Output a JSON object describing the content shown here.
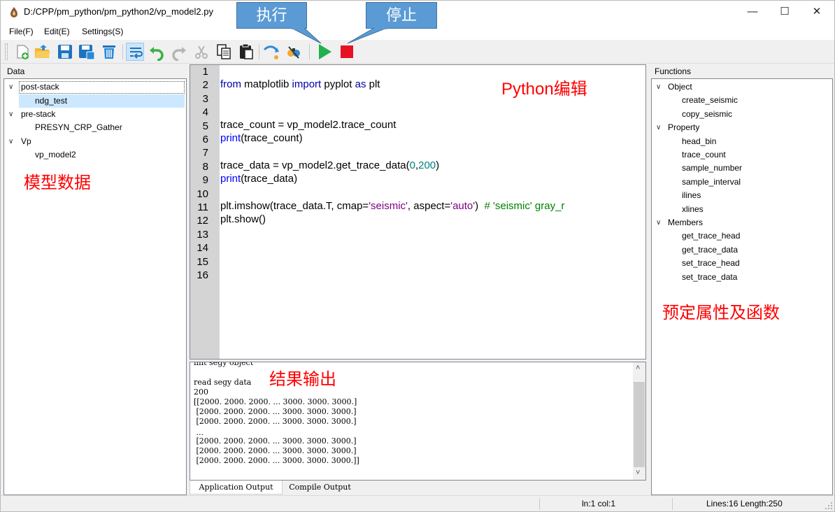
{
  "window": {
    "title": "D:/CPP/pm_python/pm_python2/vp_model2.py",
    "controls": {
      "minimize": "—",
      "maximize": "☐",
      "close": "✕"
    }
  },
  "menu": [
    {
      "label": "File(F)"
    },
    {
      "label": "Edit(E)"
    },
    {
      "label": "Settings(S)"
    }
  ],
  "toolbar": {
    "buttons": [
      "new-file-icon",
      "open-folder-icon",
      "save-icon",
      "save-as-icon",
      "delete-icon",
      "word-wrap-icon",
      "undo-icon",
      "redo-icon",
      "cut-icon",
      "copy-icon",
      "paste-icon",
      "step-icon",
      "debug-icon",
      "run-icon",
      "stop-icon"
    ],
    "run_color": "#22b14c",
    "stop_color": "#e81123"
  },
  "callouts": {
    "run": "执行",
    "stop": "停止",
    "color": "#5b9bd5"
  },
  "data_panel": {
    "header": "Data",
    "tree": [
      {
        "label": "post-stack",
        "children": [
          "ndg_test"
        ]
      },
      {
        "label": "pre-stack",
        "children": [
          "PRESYN_CRP_Gather"
        ]
      },
      {
        "label": "Vp",
        "children": [
          "vp_model2"
        ]
      }
    ],
    "selected": "ndg_test"
  },
  "editor": {
    "line_numbers": [
      "1",
      "2",
      "3",
      "4",
      "5",
      "6",
      "7",
      "8",
      "9",
      "10",
      "11",
      "12",
      "13",
      "14",
      "15",
      "16"
    ],
    "lines": {
      "l2": {
        "k1": "from",
        "t1": " matplotlib ",
        "k2": "import",
        "t2": " pyplot ",
        "k3": "as",
        "t3": " plt"
      },
      "l5": "trace_count = vp_model2.trace_count",
      "l6": {
        "f": "print",
        "t": "(trace_count)"
      },
      "l8": {
        "t1": "trace_data = vp_model2.get_trace_data(",
        "n1": "0",
        "c": ",",
        "n2": "200",
        "t2": ")"
      },
      "l9": {
        "f": "print",
        "t": "(trace_data)"
      },
      "l11": {
        "t1": "plt.imshow(trace_data.T, cmap=",
        "s1": "'seismic'",
        "t2": ", aspect=",
        "s2": "'auto'",
        "t3": ")  ",
        "cm": "# 'seismic' gray_r"
      },
      "l12": "plt.show()"
    }
  },
  "output": {
    "lines": [
      "init segy object",
      "read segy data",
      "200",
      "[[2000. 2000. 2000. ... 3000. 3000. 3000.]",
      " [2000. 2000. 2000. ... 3000. 3000. 3000.]",
      " [2000. 2000. 2000. ... 3000. 3000. 3000.]",
      " ...",
      " [2000. 2000. 2000. ... 3000. 3000. 3000.]",
      " [2000. 2000. 2000. ... 3000. 3000. 3000.]",
      " [2000. 2000. 2000. ... 3000. 3000. 3000.]]"
    ],
    "tabs": [
      "Application Output",
      "Compile Output"
    ],
    "active_tab": "Application Output"
  },
  "functions_panel": {
    "header": "Functions",
    "groups": [
      {
        "label": "Object",
        "items": [
          "create_seismic",
          "copy_seismic"
        ]
      },
      {
        "label": "Property",
        "items": [
          "head_bin",
          "trace_count",
          "sample_number",
          "sample_interval",
          "ilines",
          "xlines"
        ]
      },
      {
        "label": "Members",
        "items": [
          "get_trace_head",
          "get_trace_data",
          "set_trace_head",
          "set_trace_data"
        ]
      }
    ]
  },
  "annotations": {
    "data": "模型数据",
    "editor": "Python编辑",
    "output": "结果输出",
    "functions": "预定属性及函数",
    "color": "#ff0000"
  },
  "status": {
    "cursor": "ln:1 col:1",
    "info": "Lines:16 Length:250"
  }
}
